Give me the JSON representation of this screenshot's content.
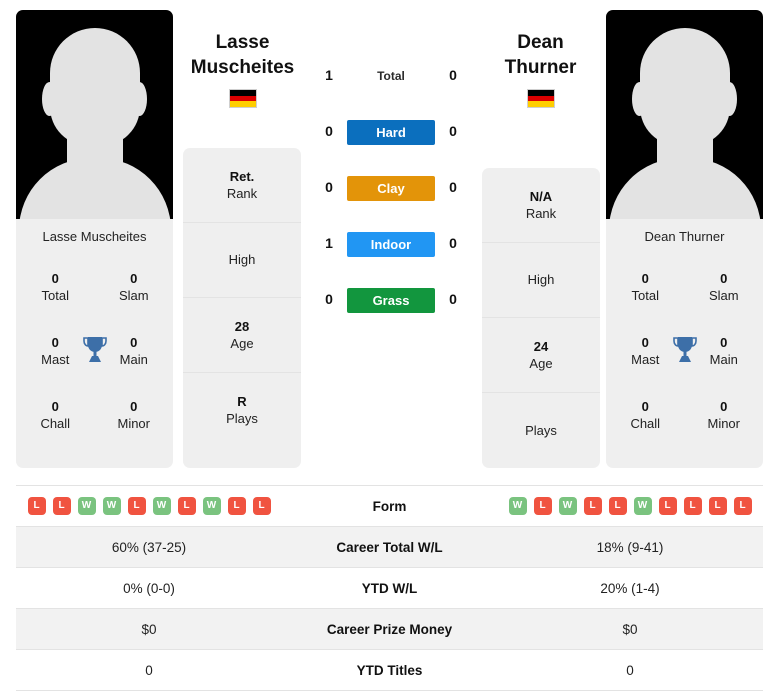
{
  "theme": {
    "card_bg": "#efefef",
    "row_shade": "#f2f2f2",
    "win_color": "#7ac37f",
    "loss_color": "#f05340",
    "trophy_color": "#3d6fa8"
  },
  "players": {
    "left": {
      "first_name": "Lasse",
      "last_name": "Muscheites",
      "full_name": "Lasse Muscheites",
      "country": "Germany",
      "flag_icon": "flag-germany",
      "photo_alt": "player-photo-placeholder",
      "titles": [
        {
          "value": "0",
          "label": "Total"
        },
        {
          "value": "0",
          "label": "Slam"
        },
        {
          "value": "0",
          "label": "Mast"
        },
        {
          "value": "0",
          "label": "Main"
        },
        {
          "value": "0",
          "label": "Chall"
        },
        {
          "value": "0",
          "label": "Minor"
        }
      ],
      "info": [
        {
          "value": "Ret.",
          "label": "Rank"
        },
        {
          "value": "",
          "label": "High"
        },
        {
          "value": "28",
          "label": "Age"
        },
        {
          "value": "R",
          "label": "Plays"
        }
      ],
      "form": [
        "L",
        "L",
        "W",
        "W",
        "L",
        "W",
        "L",
        "W",
        "L",
        "L"
      ],
      "career_total_wl": "60% (37-25)",
      "ytd_wl": "0% (0-0)",
      "career_prize_money": "$0",
      "ytd_titles": "0"
    },
    "right": {
      "first_name": "Dean",
      "last_name": "Thurner",
      "full_name": "Dean Thurner",
      "country": "Germany",
      "flag_icon": "flag-germany",
      "photo_alt": "player-photo-placeholder",
      "titles": [
        {
          "value": "0",
          "label": "Total"
        },
        {
          "value": "0",
          "label": "Slam"
        },
        {
          "value": "0",
          "label": "Mast"
        },
        {
          "value": "0",
          "label": "Main"
        },
        {
          "value": "0",
          "label": "Chall"
        },
        {
          "value": "0",
          "label": "Minor"
        }
      ],
      "info": [
        {
          "value": "N/A",
          "label": "Rank"
        },
        {
          "value": "",
          "label": "High"
        },
        {
          "value": "24",
          "label": "Age"
        },
        {
          "value": "",
          "label": "Plays"
        }
      ],
      "form": [
        "W",
        "L",
        "W",
        "L",
        "L",
        "W",
        "L",
        "L",
        "L",
        "L"
      ],
      "career_total_wl": "18% (9-41)",
      "ytd_wl": "20% (1-4)",
      "career_prize_money": "$0",
      "ytd_titles": "0"
    }
  },
  "surfaces": [
    {
      "label": "Total",
      "left_score": "1",
      "right_score": "0",
      "color": "transparent"
    },
    {
      "label": "Hard",
      "left_score": "0",
      "right_score": "0",
      "color": "#0b6fbe"
    },
    {
      "label": "Clay",
      "left_score": "0",
      "right_score": "0",
      "color": "#e39409"
    },
    {
      "label": "Indoor",
      "left_score": "1",
      "right_score": "0",
      "color": "#2196f3"
    },
    {
      "label": "Grass",
      "left_score": "0",
      "right_score": "0",
      "color": "#12963e"
    }
  ],
  "stats_table": {
    "form_label": "Form",
    "rows": [
      {
        "label": "Career Total W/L",
        "left": "60% (37-25)",
        "right": "18% (9-41)"
      },
      {
        "label": "YTD W/L",
        "left": "0% (0-0)",
        "right": "20% (1-4)"
      },
      {
        "label": "Career Prize Money",
        "left": "$0",
        "right": "$0"
      },
      {
        "label": "YTD Titles",
        "left": "0",
        "right": "0"
      }
    ]
  }
}
